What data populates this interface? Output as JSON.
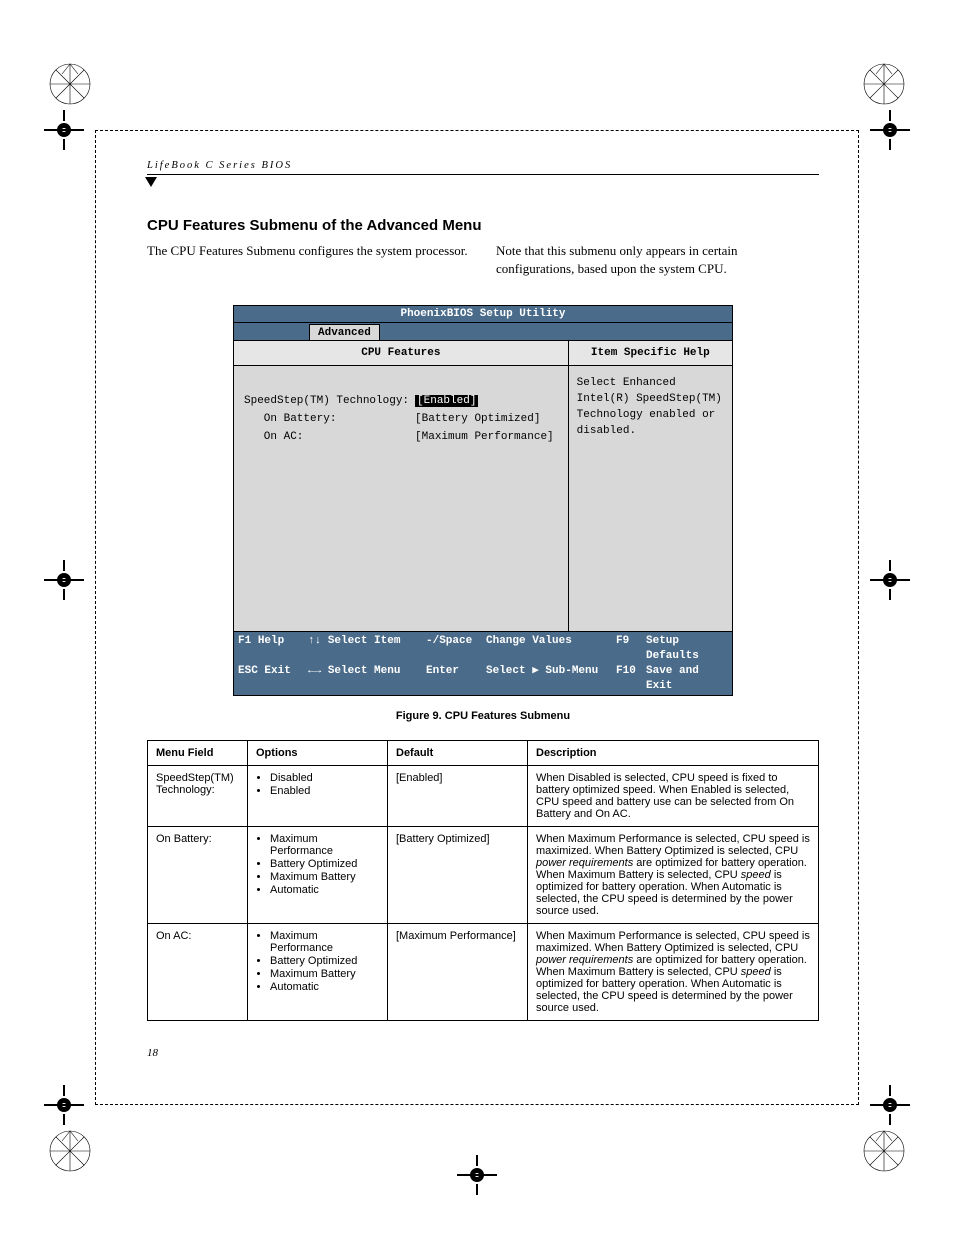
{
  "header": {
    "running": "LifeBook C Series BIOS",
    "title": "CPU Features Submenu of the Advanced Menu",
    "intro_left": "The CPU Features Submenu configures the system processor.",
    "intro_right": "Note that this submenu only appears in certain configurations, based upon the system CPU."
  },
  "bios": {
    "title": "PhoenixBIOS Setup Utility",
    "tab": "Advanced",
    "left_heading": "CPU Features",
    "right_heading": "Item Specific Help",
    "rows": [
      {
        "label": "SpeedStep(TM) Technology:",
        "value": "[Enabled]",
        "selected": true
      },
      {
        "label": "   On Battery:",
        "value": "[Battery Optimized]",
        "selected": false
      },
      {
        "label": "   On AC:",
        "value": "[Maximum Performance]",
        "selected": false
      }
    ],
    "help_text": "Select Enhanced Intel(R) SpeedStep(TM) Technology enabled or disabled.",
    "footer": {
      "r1": {
        "k1": "F1",
        "l1": "Help",
        "k2": "↑↓",
        "l2": "Select Item",
        "k3": "-/Space",
        "l3": "Change Values",
        "k4": "F9",
        "l4": "Setup Defaults"
      },
      "r2": {
        "k1": "ESC",
        "l1": "Exit",
        "k2": "←→",
        "l2": "Select Menu",
        "k3": "Enter",
        "l3": "Select ▶ Sub-Menu",
        "k4": "F10",
        "l4": "Save and Exit"
      }
    }
  },
  "caption": "Figure 9.  CPU Features Submenu",
  "table": {
    "headers": [
      "Menu Field",
      "Options",
      "Default",
      "Description"
    ],
    "rows": [
      {
        "field": "SpeedStep(TM) Technology:",
        "options": [
          "Disabled",
          "Enabled"
        ],
        "def": "[Enabled]",
        "desc": "When Disabled is selected, CPU speed is fixed to battery optimized speed. When Enabled is selected, CPU speed and battery use can be selected from On Battery and On AC."
      },
      {
        "field": "On Battery:",
        "options": [
          "Maximum Performance",
          "Battery Optimized",
          "Maximum Battery",
          "Automatic"
        ],
        "def": "[Battery Optimized]",
        "desc_parts": [
          "When Maximum Performance is selected, CPU speed is maximized. When Battery Optimized is selected, CPU ",
          "power requirements",
          " are optimized for battery operation. When Maximum Battery is selected, CPU ",
          "speed",
          " is optimized for battery operation. When Automatic is selected, the CPU speed is determined by the power source used."
        ]
      },
      {
        "field": "On AC:",
        "options": [
          "Maximum Performance",
          "Battery Optimized",
          "Maximum Battery",
          "Automatic"
        ],
        "def": "[Maximum Performance]",
        "desc_parts": [
          "When Maximum Performance is selected, CPU speed is maximized. When Battery Optimized is selected, CPU ",
          "power requirements",
          " are optimized for battery operation. When Maximum Battery is selected, CPU ",
          "speed",
          " is optimized for battery operation. When Automatic is selected, the CPU speed is determined by the power source used."
        ]
      }
    ]
  },
  "page_number": "18"
}
